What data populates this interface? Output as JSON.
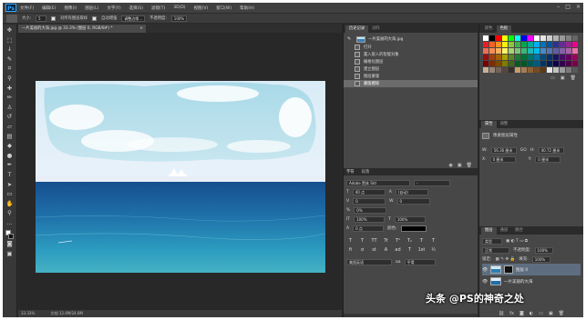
{
  "app": {
    "logo_text": "Ps",
    "menu": [
      "文件(F)",
      "编辑(E)",
      "图像(I)",
      "图层(L)",
      "文字(Y)",
      "选择(S)",
      "滤镜(T)",
      "3D(D)",
      "视图(V)",
      "窗口(W)",
      "帮助(H)"
    ],
    "window_controls": [
      "–",
      "□",
      "×"
    ]
  },
  "options_bar": {
    "size_label": "大小:",
    "size_value": "5",
    "sample_all_layers": "对所有图层取样",
    "auto_enhance_label": "自动增强",
    "enhance_label": "调整边缘...",
    "pressure_label": "不透明度:",
    "pressure_value": "100%"
  },
  "document": {
    "tab_title": "一片美丽的大海.jpg @ 33.3% (图层 0, RGB/8#) *",
    "status_zoom": "33.33%",
    "status_doc": "文档:12.4M/24.8M"
  },
  "history_panel": {
    "tabs": [
      "历史记录",
      "动作"
    ],
    "snapshot_label": "一片美丽的大海.jpg",
    "steps": [
      "打开",
      "置入嵌入的智能对象",
      "栅格化图层",
      "建立图层",
      "图层蒙版",
      "蒙版擦除"
    ],
    "footer_icons": [
      "camera-icon",
      "new-doc-icon",
      "trash-icon"
    ]
  },
  "character_panel": {
    "strip_tabs": [
      "字符",
      "段落"
    ],
    "font_family": "Adobe 黑体 Std",
    "font_style": "-",
    "font_size": "40 点",
    "leading": "(自动)",
    "kerning": "0",
    "tracking": "0",
    "vscale": "100%",
    "hscale": "100%",
    "baseline": "0 点",
    "color_label": "颜色:",
    "tsume": "0%",
    "format_buttons": [
      "T",
      "T",
      "TT",
      "Tr",
      "T¹",
      "T₁",
      "T",
      "T"
    ],
    "extra_buttons": [
      "fi",
      "ơ",
      "st",
      "A",
      "ad",
      "T",
      "1st",
      "½"
    ],
    "language": "美国英语",
    "antialias_label": "aa",
    "antialias": "平滑"
  },
  "swatches_panel": {
    "tabs": [
      "颜色",
      "色板"
    ],
    "colors": [
      "#ffffff",
      "#000000",
      "#ff0000",
      "#ffff00",
      "#00ff00",
      "#00ffff",
      "#0000ff",
      "#ff00ff",
      "#ffffff",
      "#e6e6e6",
      "#cccccc",
      "#b3b3b3",
      "#999999",
      "#808080",
      "#666666",
      "#ed1c24",
      "#f26522",
      "#f7941d",
      "#fff200",
      "#8dc63f",
      "#39b54a",
      "#00a651",
      "#00a99d",
      "#00aeef",
      "#0072bc",
      "#0054a6",
      "#2e3192",
      "#662d91",
      "#92278f",
      "#ec008c",
      "#f26c4f",
      "#f68e55",
      "#fbaf5c",
      "#fff467",
      "#acd372",
      "#7cc576",
      "#3bb878",
      "#1abbb4",
      "#00bff3",
      "#438ccb",
      "#5574b9",
      "#605ca8",
      "#8560a8",
      "#a763a8",
      "#f06ea9",
      "#9e0b0f",
      "#a0410d",
      "#a3620a",
      "#aba000",
      "#598527",
      "#1a7b30",
      "#007236",
      "#00746b",
      "#0076a3",
      "#004b80",
      "#003471",
      "#1b1464",
      "#440e62",
      "#630460",
      "#9e005d",
      "#790000",
      "#7b2e00",
      "#7d4900",
      "#827b00",
      "#406618",
      "#005e20",
      "#005826",
      "#005952",
      "#005b7f",
      "#003663",
      "#002157",
      "#0d004c",
      "#32004b",
      "#4b0049",
      "#7b0046",
      "#c7b299",
      "#998675",
      "#736357",
      "#534741",
      "#37302d",
      "#c69c6d",
      "#a67c52",
      "#8c6239",
      "#754c24",
      "#603913",
      "#e6e6e6",
      "#c2c2c2",
      "#9e9e9e",
      "#7a7a7a",
      "#595959"
    ],
    "footer_icons": [
      "folder-icon",
      "new-swatch-icon",
      "trash-icon"
    ]
  },
  "properties_panel": {
    "tabs": [
      "属性",
      "调整"
    ],
    "mask_title": "像素图层属性",
    "w_label": "W:",
    "w_value": "56.36 厘米",
    "link_label": "GO",
    "h_label": "H:",
    "h_value": "40.72 厘米",
    "x_label": "X:",
    "x_value": "0 厘米",
    "y_label": "Y:",
    "y_value": "0 厘米"
  },
  "layers_panel": {
    "tabs": [
      "图层",
      "通道",
      "路径"
    ],
    "kind_label": "类型",
    "blend_mode": "正常",
    "opacity_label": "不透明度:",
    "opacity_value": "100%",
    "lock_label": "锁定:",
    "fill_label": "填充:",
    "fill_value": "100%",
    "layers": [
      {
        "name": "图层 0",
        "selected": true
      },
      {
        "name": "一片美丽的大海",
        "selected": false
      }
    ],
    "footer_icons": [
      "link-icon",
      "fx-icon",
      "mask-icon",
      "adjust-icon",
      "group-icon",
      "new-layer-icon",
      "trash-icon"
    ]
  },
  "watermark": "头条 @PS的神奇之处"
}
